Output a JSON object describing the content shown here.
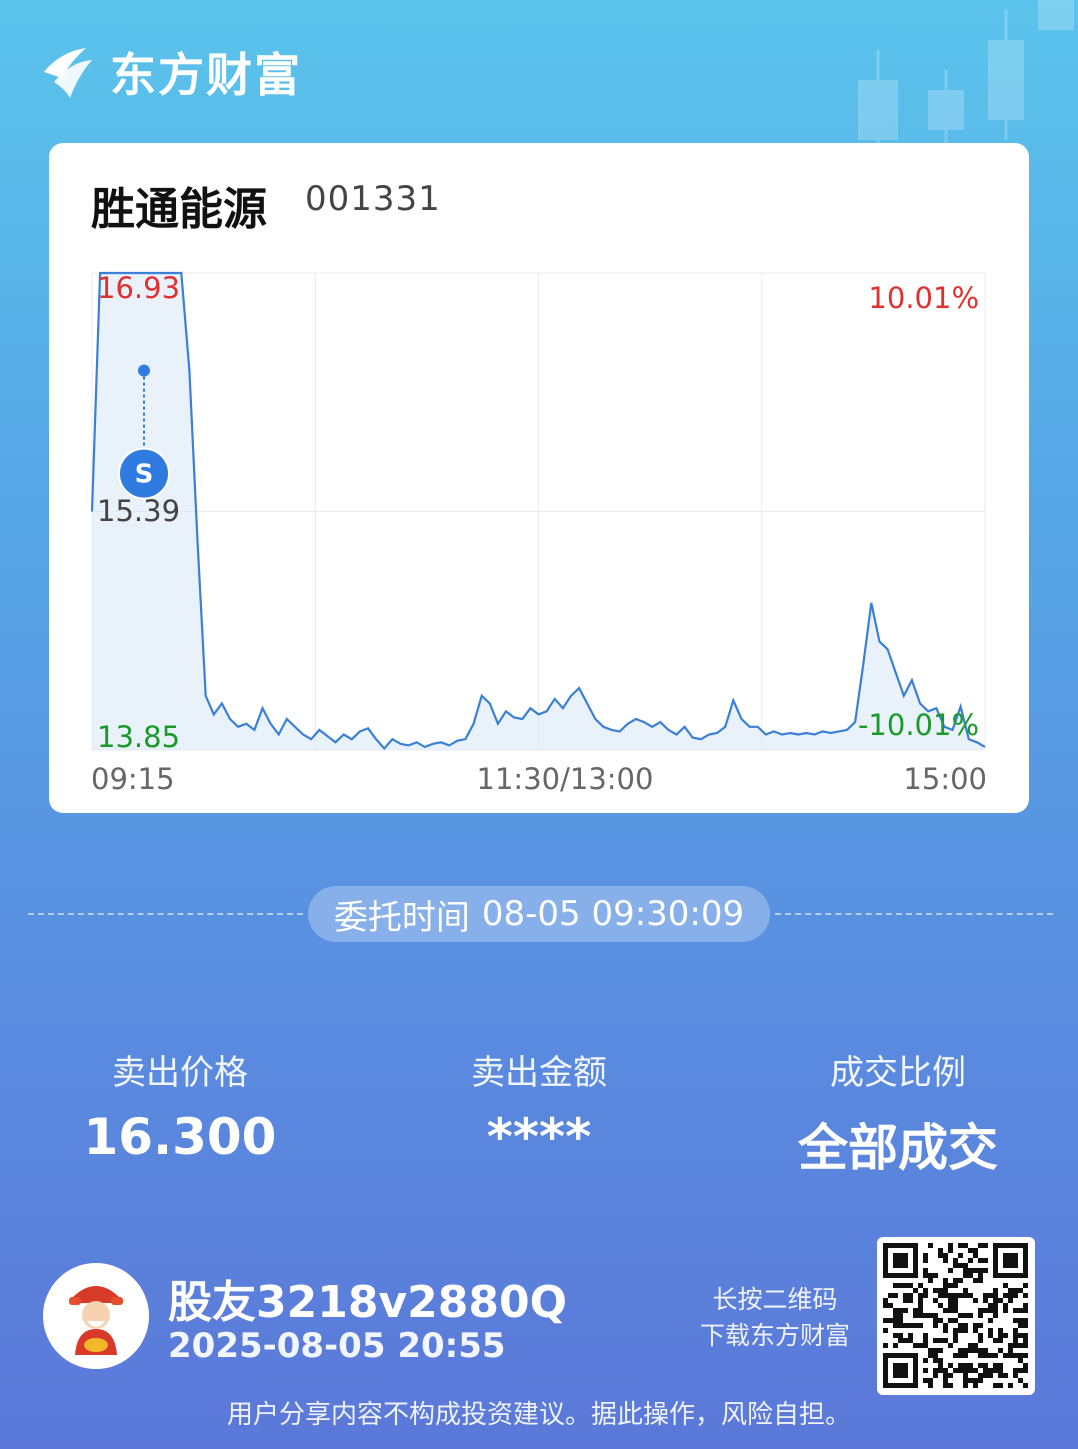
{
  "brand": {
    "name": "东方财富"
  },
  "stock": {
    "name": "胜通能源",
    "code": "001331"
  },
  "chart_data": {
    "type": "line",
    "title": "",
    "y_labels": {
      "high": "16.93",
      "mid": "15.39",
      "low": "13.85"
    },
    "pct_labels": {
      "high": "10.01%",
      "low": "-10.01%"
    },
    "x_labels": [
      "09:15",
      "11:30/13:00",
      "15:00"
    ],
    "ylim": [
      13.85,
      16.93
    ],
    "grid": true,
    "marker": {
      "label": "S",
      "price": 16.3
    },
    "series": [
      {
        "values": [
          15.39,
          16.93,
          16.93,
          16.93,
          16.93,
          16.93,
          16.93,
          16.93,
          16.93,
          16.93,
          16.93,
          16.93,
          16.3,
          15.2,
          14.2,
          14.08,
          14.15,
          14.05,
          14.0,
          14.02,
          13.98,
          14.12,
          14.02,
          13.95,
          14.05,
          14.0,
          13.95,
          13.92,
          13.98,
          13.94,
          13.9,
          13.95,
          13.92,
          13.97,
          13.99,
          13.92,
          13.86,
          13.92,
          13.89,
          13.88,
          13.9,
          13.87,
          13.89,
          13.9,
          13.88,
          13.91,
          13.92,
          14.02,
          14.2,
          14.15,
          14.02,
          14.1,
          14.06,
          14.05,
          14.12,
          14.08,
          14.1,
          14.18,
          14.12,
          14.2,
          14.25,
          14.15,
          14.05,
          14.0,
          13.98,
          13.97,
          14.02,
          14.05,
          14.03,
          14.0,
          14.03,
          13.98,
          13.95,
          14.0,
          13.93,
          13.92,
          13.95,
          13.96,
          14.0,
          14.17,
          14.05,
          14.0,
          14.0,
          13.95,
          13.97,
          13.95,
          13.96,
          13.95,
          13.96,
          13.95,
          13.97,
          13.96,
          13.97,
          13.98,
          14.03,
          14.4,
          14.8,
          14.55,
          14.5,
          14.35,
          14.2,
          14.3,
          14.15,
          14.1,
          14.12,
          14.0,
          13.98,
          14.13,
          13.92,
          13.9,
          13.87
        ]
      }
    ]
  },
  "order": {
    "label": "委托时间",
    "value": "08-05 09:30:09"
  },
  "stats": [
    {
      "label": "卖出价格",
      "value": "16.300"
    },
    {
      "label": "卖出金额",
      "value": "****"
    },
    {
      "label": "成交比例",
      "value": "全部成交"
    }
  ],
  "user": {
    "name": "股友3218v2880Q",
    "time": "2025-08-05 20:55"
  },
  "qr": {
    "hint_line1": "长按二维码",
    "hint_line2": "下载东方财富"
  },
  "disclaimer": "用户分享内容不构成投资建议。据此操作，风险自担。",
  "colors": {
    "up": "#e03030",
    "down": "#1a9a2a",
    "line": "#3a7fd8",
    "marker": "#2f7be0"
  }
}
